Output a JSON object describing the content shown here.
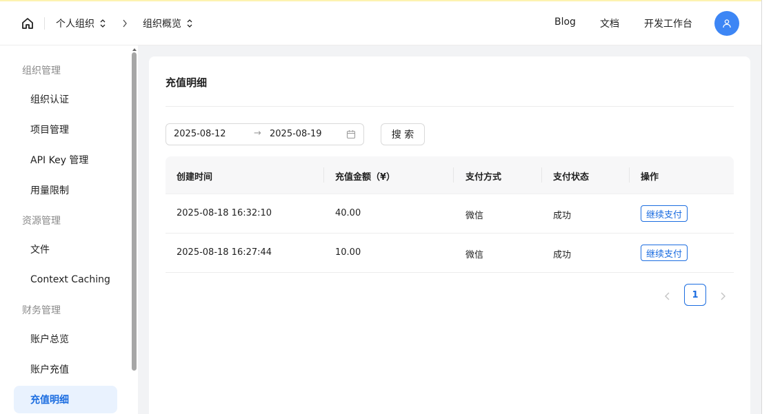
{
  "header": {
    "breadcrumb": [
      {
        "label": "个人组织"
      },
      {
        "label": "组织概览"
      }
    ],
    "nav": [
      "Blog",
      "文档",
      "开发工作台"
    ]
  },
  "sidebar": {
    "groups": [
      {
        "label": "组织管理",
        "items": [
          "组织认证",
          "项目管理",
          "API Key 管理",
          "用量限制"
        ]
      },
      {
        "label": "资源管理",
        "items": [
          "文件",
          "Context Caching"
        ]
      },
      {
        "label": "财务管理",
        "items": [
          "账户总览",
          "账户充值",
          "充值明细"
        ]
      }
    ],
    "active": "充值明细"
  },
  "page": {
    "title": "充值明细",
    "filter": {
      "start_date": "2025-08-12",
      "arrow": "→",
      "end_date": "2025-08-19",
      "search_label": "搜 索"
    },
    "table": {
      "columns": [
        "创建时间",
        "充值金额（¥）",
        "支付方式",
        "支付状态",
        "操作"
      ],
      "rows": [
        {
          "time": "2025-08-18 16:32:10",
          "amount": "40.00",
          "method": "微信",
          "status": "成功",
          "action": "继续支付"
        },
        {
          "time": "2025-08-18 16:27:44",
          "amount": "10.00",
          "method": "微信",
          "status": "成功",
          "action": "继续支付"
        }
      ]
    },
    "pagination": {
      "current": "1"
    }
  },
  "colors": {
    "accent": "#1a6ce0",
    "avatar": "#3d86f5",
    "active_bg": "#e9f2fe"
  }
}
